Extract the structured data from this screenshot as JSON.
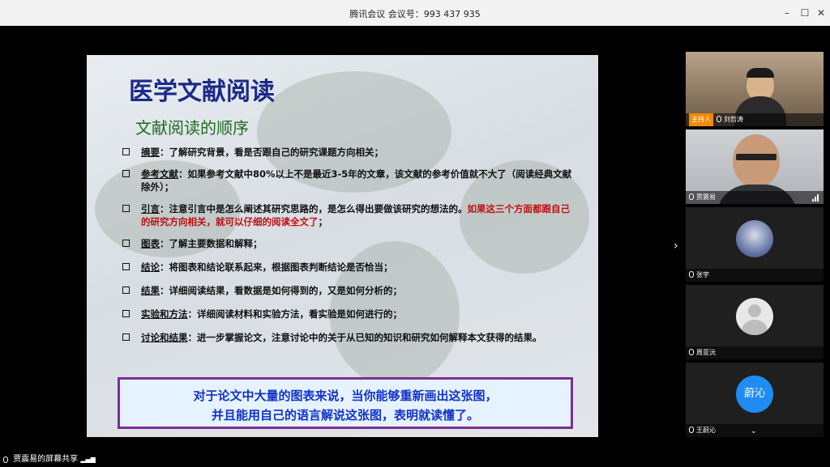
{
  "window": {
    "title": "腾讯会议 会议号：993 437 935",
    "min_icon": "minimize-icon",
    "max_icon": "maximize-icon",
    "close_icon": "close-icon"
  },
  "slide": {
    "title": "医学文献阅读",
    "subtitle": "文献阅读的顺序",
    "items": [
      {
        "term": "摘要",
        "text": "：了解研究背景，看是否跟自己的研究课题方向相关；",
        "emph": "",
        "tail": ""
      },
      {
        "term": "参考文献",
        "text": "：如果参考文献中80%以上不是最近3-5年的文章，该文献的参考价值就不大了（阅读经典文献除外）；",
        "emph": "",
        "tail": ""
      },
      {
        "term": "引言",
        "text": "：注意引言中是怎么阐述其研究思路的，是怎么得出要做该研究的想法的。",
        "emph": "如果这三个方面都跟自己的研究方向相关，就可以仔细的阅读全文了",
        "tail": "；"
      },
      {
        "term": "图表",
        "text": "：了解主要数据和解释；",
        "emph": "",
        "tail": ""
      },
      {
        "term": "结论",
        "text": "：将图表和结论联系起来，根据图表判断结论是否恰当；",
        "emph": "",
        "tail": ""
      },
      {
        "term": "结果",
        "text": "：详细阅读结果，看数据是如何得到的，又是如何分析的；",
        "emph": "",
        "tail": ""
      },
      {
        "term": "实验和方法",
        "text": "：详细阅读材料和实验方法，看实验是如何进行的；",
        "emph": "",
        "tail": ""
      },
      {
        "term": "讨论和结果",
        "text": "：进一步掌握论文，注意讨论中的关于从已知的知识和研究如何解释本文获得的结果。",
        "emph": "",
        "tail": ""
      }
    ],
    "callout_line1": "对于论文中大量的图表来说，当你能够重新画出这张图，",
    "callout_line2": "并且能用自己的语言解说这张图，表明就读懂了。"
  },
  "participants": [
    {
      "name": "刘哲涛",
      "host_label": "主持人",
      "type": "video"
    },
    {
      "name": "贾震易",
      "type": "video"
    },
    {
      "name": "张宇",
      "type": "avatar-photo"
    },
    {
      "name": "周亚沅",
      "type": "avatar-blank"
    },
    {
      "name": "王蔚沁",
      "type": "avatar-text",
      "avatar_text": "蔚沁"
    }
  ],
  "status": {
    "text": "贾震易的屏幕共享"
  },
  "colors": {
    "accent": "#1e8cf0",
    "host_badge": "#f28b00",
    "slide_title": "#1b2a88",
    "callout_border": "#7a2f95"
  }
}
